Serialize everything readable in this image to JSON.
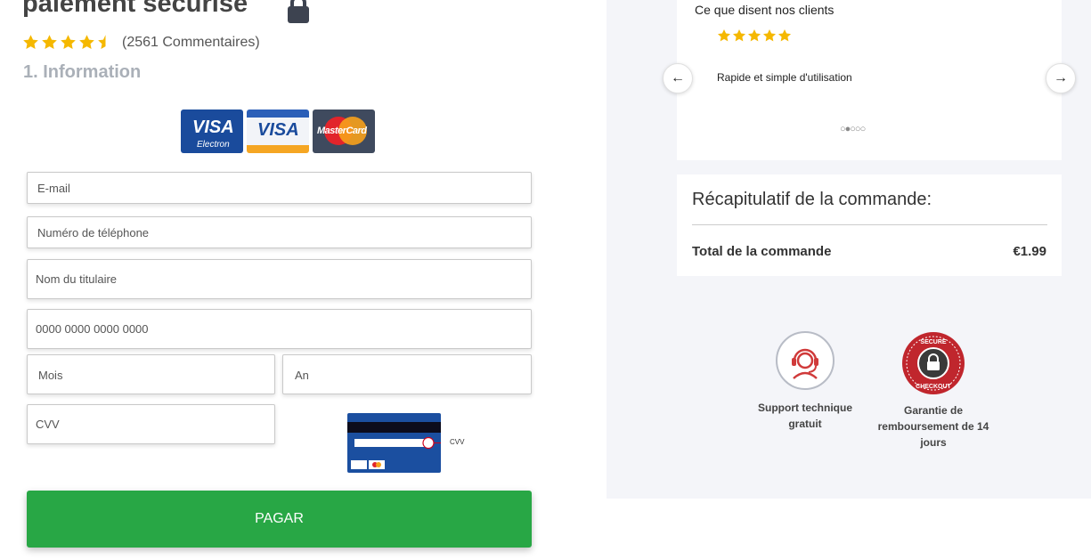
{
  "header": {
    "title": "paiement sécurisé",
    "rating": 4.5,
    "reviews_label": "(2561 Commentaires)",
    "step_title": "1. Information"
  },
  "payment_logos": [
    {
      "name": "visa-electron-logo",
      "brand": "VISA",
      "sub": "Electron"
    },
    {
      "name": "visa-logo",
      "brand": "VISA"
    },
    {
      "name": "mastercard-logo",
      "brand": "MasterCard"
    }
  ],
  "form": {
    "email_placeholder": "E-mail",
    "phone_placeholder": "Numéro de téléphone",
    "holder_placeholder": "Nom du titulaire",
    "card_number_placeholder": "0000 0000 0000 0000",
    "month_value": "Mois",
    "year_value": "An",
    "cvv_placeholder": "CVV",
    "cvv_hint": "CVV",
    "pay_label": "PAGAR"
  },
  "testimonial": {
    "heading": "Ce que disent nos clients",
    "rating": 5,
    "text": "Rapide et simple d'utilisation",
    "dots": "○●○○○",
    "prev_icon": "←",
    "next_icon": "→"
  },
  "summary": {
    "title": "Récapitulatif de la commande:",
    "total_label": "Total de la commande",
    "total_value": "€1.99"
  },
  "badges": {
    "support_label": "Support technique gratuit",
    "guarantee_label": "Garantie de remboursement de 14 jours",
    "seal_top": "SECURE",
    "seal_bottom": "CHECKOUT"
  },
  "colors": {
    "star": "#f5b800",
    "pay_button": "#28a745",
    "seal": "#c0262d",
    "support_icon": "#d03a3a"
  }
}
